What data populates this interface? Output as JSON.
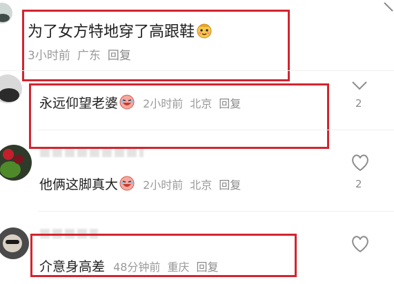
{
  "comments": [
    {
      "text": "为了女方特地穿了高跟鞋",
      "time": "3小时前",
      "location": "广东",
      "reply": "回复",
      "emoji": "smug-face-emoji"
    },
    {
      "text": "永远仰望老婆",
      "time": "2小时前",
      "location": "北京",
      "reply": "回复",
      "likes": "2",
      "emoji": "crying-laugh-emoji"
    },
    {
      "text": "他俩这脚真大",
      "time": "2小时前",
      "location": "北京",
      "reply": "回复",
      "likes": "2",
      "emoji": "crying-laugh-emoji"
    },
    {
      "text": "介意身高差",
      "time": "48分钟前",
      "location": "重庆",
      "reply": "回复"
    }
  ],
  "colors": {
    "highlight": "#d3242e",
    "meta": "#9a9a9a",
    "text": "#1f1f1f"
  }
}
